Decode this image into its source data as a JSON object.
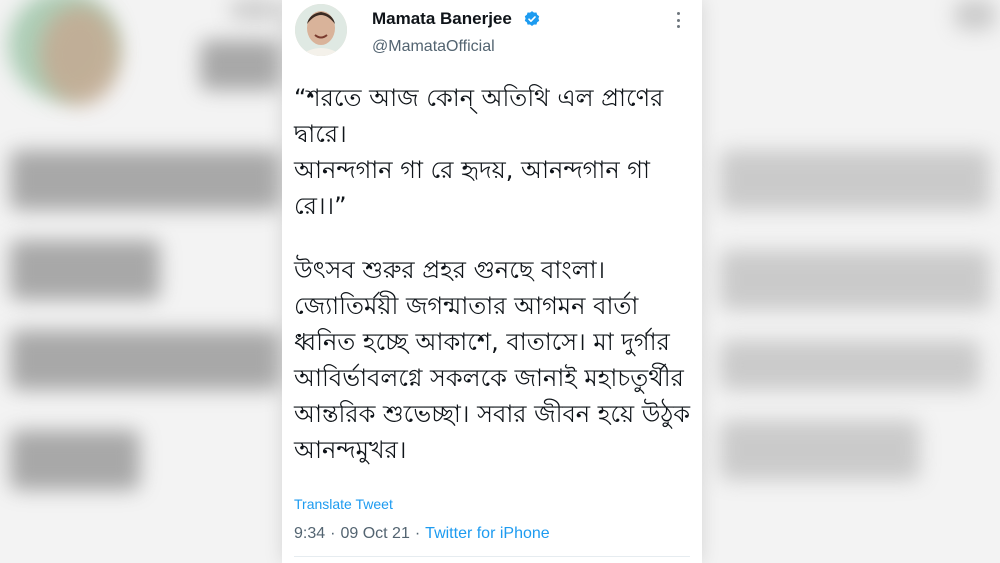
{
  "user": {
    "name": "Mamata Banerjee",
    "handle": "@MamataOfficial",
    "verified": true
  },
  "icons": {
    "verified": "verified-badge-icon",
    "more": "more-options-icon"
  },
  "tweet": {
    "quote": "“শরতে আজ কোন্ অতিথি এল প্রাণের দ্বারে।\n আনন্দগান গা রে হৃদয়, আনন্দগান গা রে।।”",
    "message": "উৎসব শুরুর প্রহর গুনছে বাংলা। জ্যোতির্ময়ী জগন্মাতার আগমন বার্তা ধ্বনিত হচ্ছে আকাশে, বাতাসে। মা দুর্গার আবির্ভাবলগ্নে সকলকে জানাই মহাচতুর্থীর আন্তরিক শুভেচ্ছা। সবার জীবন হয়ে উঠুক আনন্দমুখর।",
    "translate_label": "Translate Tweet",
    "time": "9:34",
    "date": "09 Oct 21",
    "source": "Twitter for iPhone",
    "separator": "·"
  },
  "colors": {
    "accent": "#1d9bf0",
    "text": "#0f1419",
    "muted": "#536471"
  }
}
